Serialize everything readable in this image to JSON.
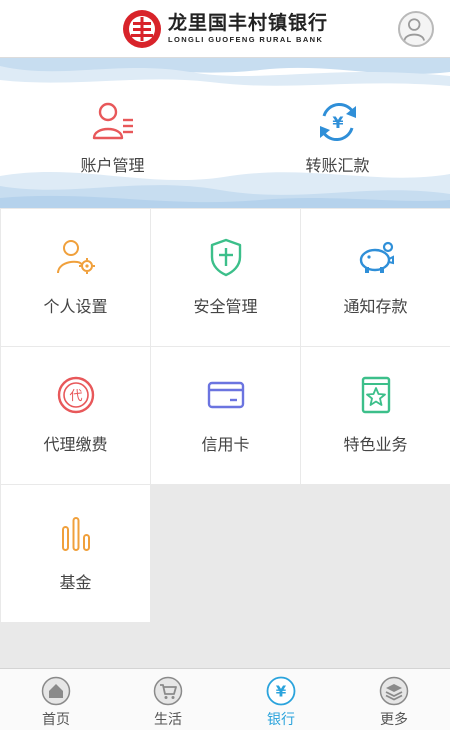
{
  "header": {
    "bank_name_cn": "龙里国丰村镇银行",
    "bank_name_en": "LONGLI GUOFENG RURAL BANK",
    "logo_icon": "bank-logo",
    "avatar_icon": "user-avatar-icon"
  },
  "banner": {
    "items": [
      {
        "label": "账户管理",
        "icon": "account-management-icon",
        "color": "#e8585a"
      },
      {
        "label": "转账汇款",
        "icon": "transfer-icon",
        "color": "#2f8fd8"
      }
    ]
  },
  "grid": {
    "items": [
      {
        "label": "个人设置",
        "icon": "person-settings-icon",
        "color": "#f0a03c"
      },
      {
        "label": "安全管理",
        "icon": "shield-icon",
        "color": "#3cbf8a"
      },
      {
        "label": "通知存款",
        "icon": "piggy-bank-icon",
        "color": "#2f8fd8"
      },
      {
        "label": "代理缴费",
        "icon": "agency-payment-icon",
        "color": "#e8585a"
      },
      {
        "label": "信用卡",
        "icon": "credit-card-icon",
        "color": "#6b74e0"
      },
      {
        "label": "特色业务",
        "icon": "featured-service-icon",
        "color": "#3cbf8a"
      },
      {
        "label": "基金",
        "icon": "fund-chart-icon",
        "color": "#f0a03c"
      }
    ],
    "agency_badge": "代"
  },
  "tabbar": {
    "active_color": "#2aa3dc",
    "tabs": [
      {
        "label": "首页",
        "icon": "home-icon",
        "active": false
      },
      {
        "label": "生活",
        "icon": "shopping-cart-icon",
        "active": false
      },
      {
        "label": "银行",
        "icon": "yuan-icon",
        "active": true
      },
      {
        "label": "更多",
        "icon": "layers-icon",
        "active": false
      }
    ]
  }
}
